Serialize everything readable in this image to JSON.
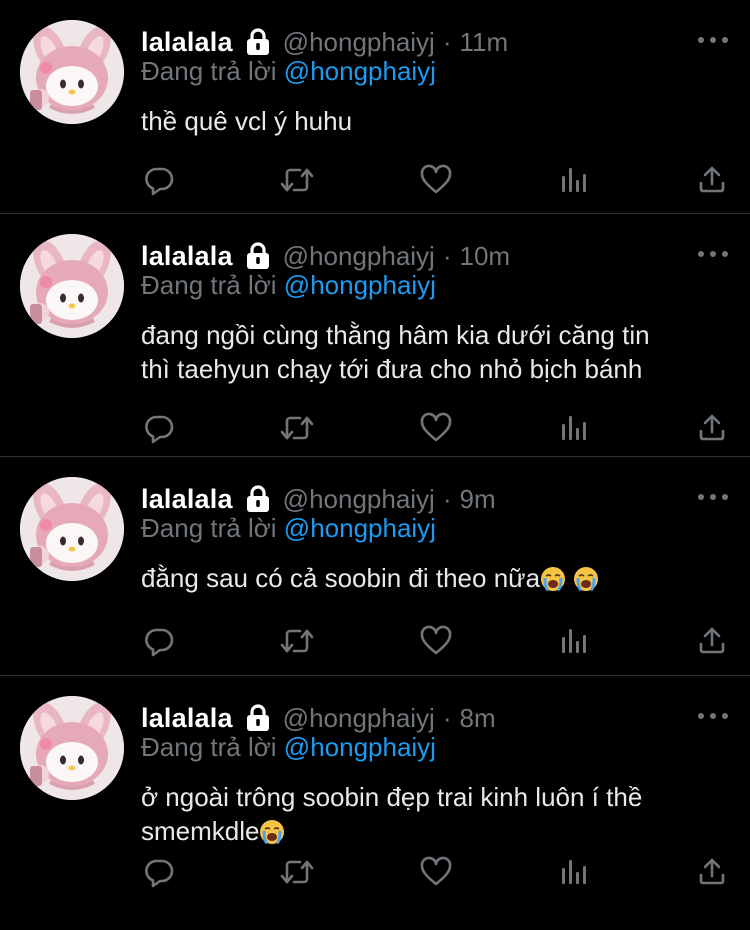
{
  "colors": {
    "background": "#000000",
    "divider": "#2f3336",
    "primary_text": "#e7e9ea",
    "secondary_text": "#71767b",
    "mention": "#1d9bf0"
  },
  "icons": {
    "avatar": "pink-rabbit-plush-avatar",
    "protected": "lock-icon",
    "more": "more-dots-icon",
    "reply": "reply-icon",
    "retweet": "retweet-icon",
    "like": "heart-icon",
    "views": "analytics-icon",
    "share": "share-icon",
    "emoji": "loudly-crying-face-emoji"
  },
  "tweets": [
    {
      "display_name": "lalalala",
      "handle": "@hongphaiyj",
      "separator": "·",
      "time": "11m",
      "reply_prefix": "Đang trả lời",
      "reply_to": "@hongphaiyj",
      "text": "thề quê vcl ý huhu",
      "emoji_text": ""
    },
    {
      "display_name": "lalalala",
      "handle": "@hongphaiyj",
      "separator": "·",
      "time": "10m",
      "reply_prefix": "Đang trả lời",
      "reply_to": "@hongphaiyj",
      "text": "đang ngồi cùng thằng hâm kia dưới căng tin\nthì taehyun chạy tới đưa cho nhỏ bịch bánh",
      "emoji_text": ""
    },
    {
      "display_name": "lalalala",
      "handle": "@hongphaiyj",
      "separator": "·",
      "time": "9m",
      "reply_prefix": "Đang trả lời",
      "reply_to": "@hongphaiyj",
      "text": "đằng sau có cả soobin đi theo nữa",
      "emoji_text": "😭 😭"
    },
    {
      "display_name": "lalalala",
      "handle": "@hongphaiyj",
      "separator": "·",
      "time": "8m",
      "reply_prefix": "Đang trả lời",
      "reply_to": "@hongphaiyj",
      "text": "ở ngoài trông soobin đẹp trai kinh luôn í thề\nsmemkdle",
      "emoji_text": "😭"
    }
  ]
}
